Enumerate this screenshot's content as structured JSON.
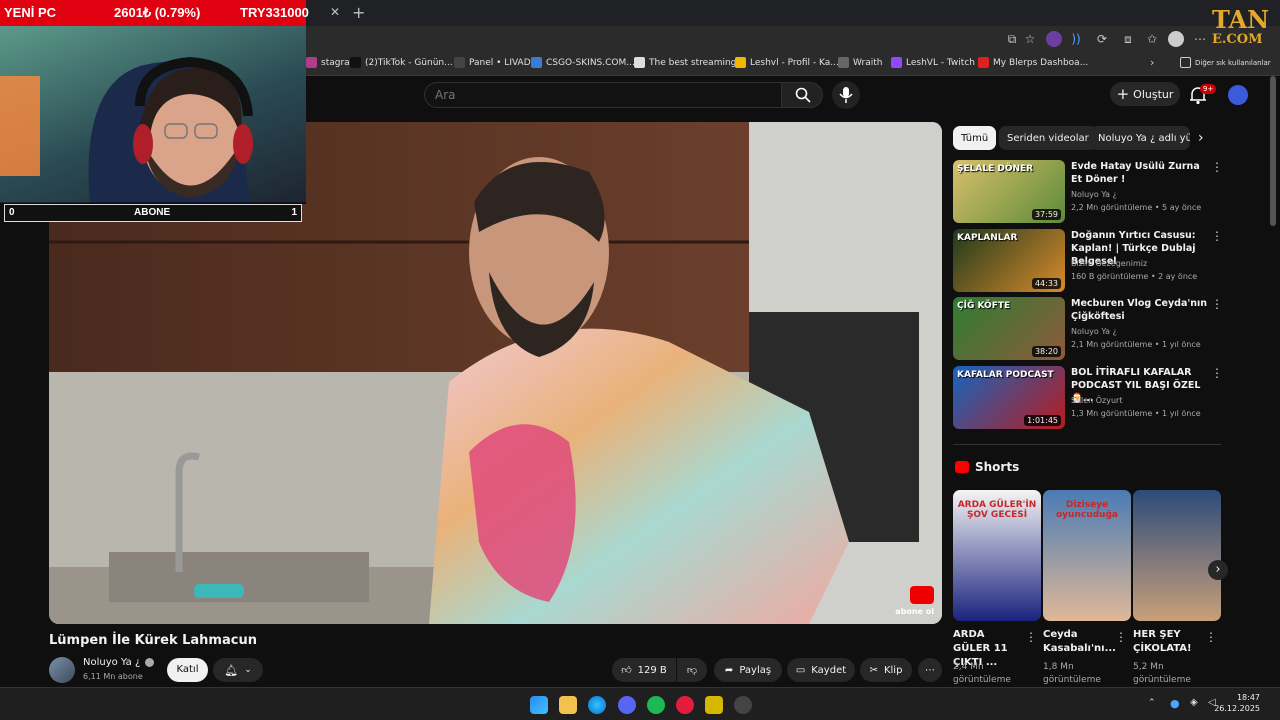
{
  "overlay": {
    "ticker_left": "YENİ PC",
    "ticker_mid": "2601₺ (0.79%)",
    "ticker_right": "TRY331000",
    "counter_left": "0",
    "counter_label": "ABONE",
    "counter_right": "1",
    "logo_line1": "TAN",
    "logo_line2": "E.COM"
  },
  "browser": {
    "bookmarks": [
      {
        "label": "stagram",
        "color": "#b03d8c"
      },
      {
        "label": "(2)TikTok - Günün...",
        "color": "#111111"
      },
      {
        "label": "Panel • LIVAD",
        "color": "#444444"
      },
      {
        "label": "CSGO-SKINS.COM...",
        "color": "#3a7bd5"
      },
      {
        "label": "The best streaming...",
        "color": "#dddddd"
      },
      {
        "label": "Leshvl - Profil - Ka...",
        "color": "#f2b600"
      },
      {
        "label": "Wraith",
        "color": "#666666"
      },
      {
        "label": "LeshVL - Twitch",
        "color": "#9146ff"
      },
      {
        "label": "My Blerps Dashboa...",
        "color": "#e02020"
      }
    ],
    "other_bookmarks": "Diğer sık kullanılanlar"
  },
  "youtube": {
    "search_placeholder": "Ara",
    "create_label": "Oluştur",
    "notif_count": "9+"
  },
  "video": {
    "title": "Lümpen İle Kürek Lahmacun",
    "channel": "Noluyo Ya ¿",
    "subs": "6,11 Mn abone",
    "join": "Katıl",
    "likes": "129 B",
    "share": "Paylaş",
    "save": "Kaydet",
    "clip": "Klip",
    "watermark": "abone ol"
  },
  "sidebar": {
    "chips": [
      "Tümü",
      "Seriden videolar",
      "Noluyo Ya ¿ adlı yük"
    ],
    "recs": [
      {
        "title": "Evde Hatay Usülü Zurna Et Döner !",
        "channel": "Noluyo Ya ¿",
        "meta": "2,2 Mn görüntüleme • 5 ay önce",
        "duration": "37:59",
        "thumb_text": "ŞELALE DÖNER",
        "c1": "#d9c06a",
        "c2": "#5d8a3a"
      },
      {
        "title": "Doğanın Yırtıcı Casusu: Kaplan! | Türkçe Dublaj Belgesel",
        "channel": "Bizim Gezegenimiz",
        "meta": "160 B görüntüleme • 2 ay önce",
        "duration": "44:33",
        "thumb_text": "KAPLANLAR",
        "c1": "#1f3a1c",
        "c2": "#d98a2b"
      },
      {
        "title": "Mecburen Vlog Ceyda'nın Çiğköftesi",
        "channel": "Noluyo Ya ¿",
        "meta": "2,1 Mn görüntüleme • 1 yıl önce",
        "duration": "38:20",
        "thumb_text": "ÇİĞ KÖFTE",
        "c1": "#2e7d32",
        "c2": "#8d5a3b"
      },
      {
        "title": "BOL İTİRAFLI KAFALAR PODCAST YIL BAŞI ÖZEL 🎅...",
        "channel": "Selen Özyurt",
        "meta": "1,3 Mn görüntüleme • 1 yıl önce",
        "duration": "1:01:45",
        "thumb_text": "KAFALAR PODCAST",
        "c1": "#1565c0",
        "c2": "#b71c1c"
      }
    ],
    "shorts_heading": "Shorts",
    "shorts": [
      {
        "title": "ARDA GÜLER 11 ÇIKTI ...",
        "views": "2,4 Mn görüntüleme",
        "overlay": "ARDA GÜLER'İN ŞOV GECESİ",
        "c1": "#f5f5f5",
        "c2": "#1a237e"
      },
      {
        "title": "Ceyda Kasabalı'nı...",
        "views": "1,8 Mn görüntüleme",
        "overlay": "Diziseye oyuncuduğa",
        "c1": "#4a7bb5",
        "c2": "#e0b897"
      },
      {
        "title": "HER ŞEY ÇİKOLATA!",
        "views": "5,2 Mn görüntüleme",
        "overlay": "",
        "c1": "#2d4b7a",
        "c2": "#c9a07a"
      }
    ]
  },
  "taskbar": {
    "time": "18:47",
    "date": "26.12.2025"
  }
}
